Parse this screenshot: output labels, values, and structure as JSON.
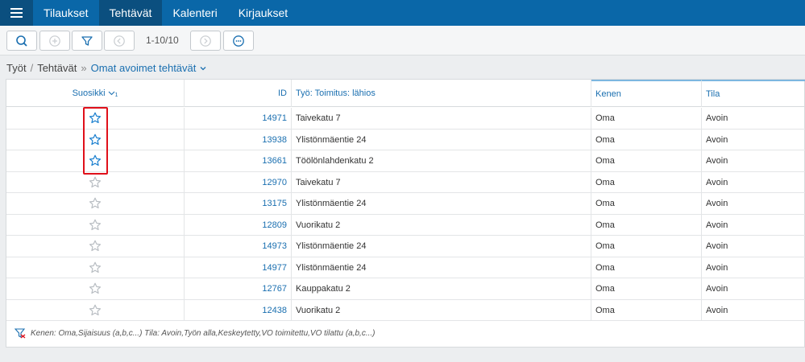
{
  "nav": {
    "tabs": [
      {
        "label": "Tilaukset"
      },
      {
        "label": "Tehtävät"
      },
      {
        "label": "Kalenteri"
      },
      {
        "label": "Kirjaukset"
      }
    ]
  },
  "toolbar": {
    "pager_text": "1-10/10"
  },
  "breadcrumb": {
    "root": "Työt",
    "sep1": "/",
    "level2": "Tehtävät",
    "sep2": "»",
    "current": "Omat avoimet tehtävät"
  },
  "grid": {
    "headers": {
      "favorite": "Suosikki",
      "sort_index": "1",
      "id": "ID",
      "work": "Työ: Toimitus: lähios",
      "owner": "Kenen",
      "status": "Tila"
    },
    "rows": [
      {
        "favorite": true,
        "id": "14971",
        "work": "Taivekatu 7",
        "owner": "Oma",
        "status": "Avoin"
      },
      {
        "favorite": true,
        "id": "13938",
        "work": "Ylistönmäentie 24",
        "owner": "Oma",
        "status": "Avoin"
      },
      {
        "favorite": true,
        "id": "13661",
        "work": "Töölönlahdenkatu 2",
        "owner": "Oma",
        "status": "Avoin"
      },
      {
        "favorite": false,
        "id": "12970",
        "work": "Taivekatu 7",
        "owner": "Oma",
        "status": "Avoin"
      },
      {
        "favorite": false,
        "id": "13175",
        "work": "Ylistönmäentie 24",
        "owner": "Oma",
        "status": "Avoin"
      },
      {
        "favorite": false,
        "id": "12809",
        "work": "Vuorikatu 2",
        "owner": "Oma",
        "status": "Avoin"
      },
      {
        "favorite": false,
        "id": "14973",
        "work": "Ylistönmäentie 24",
        "owner": "Oma",
        "status": "Avoin"
      },
      {
        "favorite": false,
        "id": "14977",
        "work": "Ylistönmäentie 24",
        "owner": "Oma",
        "status": "Avoin"
      },
      {
        "favorite": false,
        "id": "12767",
        "work": "Kauppakatu 2",
        "owner": "Oma",
        "status": "Avoin"
      },
      {
        "favorite": false,
        "id": "12438",
        "work": "Vuorikatu 2",
        "owner": "Oma",
        "status": "Avoin"
      }
    ],
    "filter_summary": "Kenen: Oma,Sijaisuus (a,b,c...) Tila: Avoin,Työn alla,Keskeytetty,VO toimitettu,VO tilattu (a,b,c...)"
  },
  "colors": {
    "nav_bg": "#0a67a8",
    "nav_active": "#0b4f7f",
    "link": "#1a6fb0",
    "star_active": "#1a7fcf",
    "star_inactive": "#b9bec3",
    "highlight": "#e0101a"
  }
}
